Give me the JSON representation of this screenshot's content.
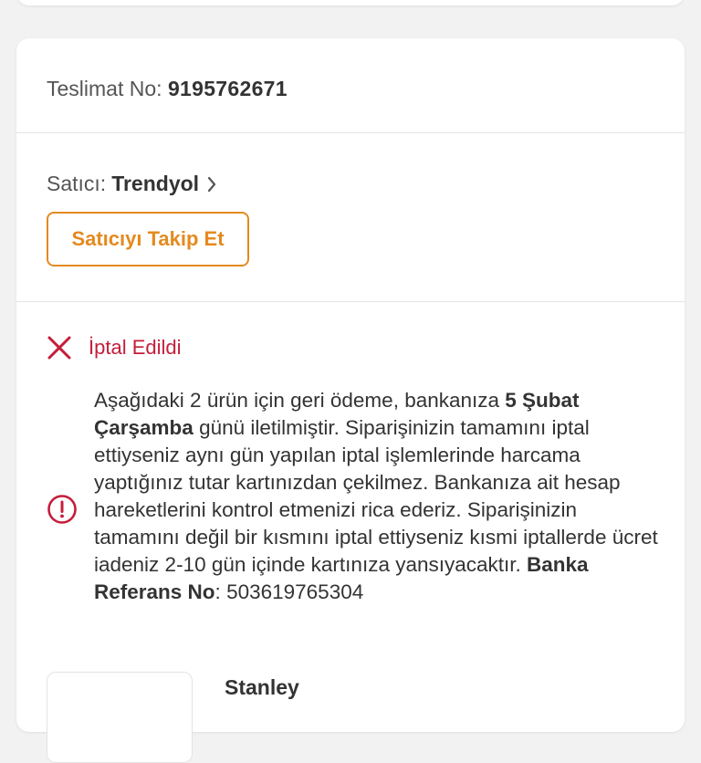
{
  "delivery": {
    "label": "Teslimat No:",
    "number": "9195762671"
  },
  "seller": {
    "label": "Satıcı:",
    "name": "Trendyol",
    "follow_button": "Satıcıyı Takip Et"
  },
  "status": {
    "text": "İptal Edildi",
    "icon": "close-icon",
    "color": "#c41e3a"
  },
  "refund_info": {
    "icon": "info-icon",
    "part1": "Aşağıdaki 2 ürün için geri ödeme, bankanıza ",
    "date": "5 Şubat Çarşamba",
    "part2": " günü iletilmiştir. Siparişinizin tamamını iptal ettiyseniz aynı gün yapılan iptal işlemlerinde harcama yaptığınız tutar kartınızdan çekilmez. Bankanıza ait hesap hareketlerini kontrol etmenizi rica ederiz. Siparişinizin tamamını değil bir kısmını iptal ettiyseniz kısmi iptallerde ücret iadeniz 2-10 gün içinde kartınıza yansıyacaktır. ",
    "ref_label": "Banka Referans No",
    "ref_sep": ":",
    "ref_number": "503619765304"
  },
  "product": {
    "brand": "Stanley"
  },
  "colors": {
    "accent": "#e48a1f",
    "cancel": "#c41e3a"
  }
}
